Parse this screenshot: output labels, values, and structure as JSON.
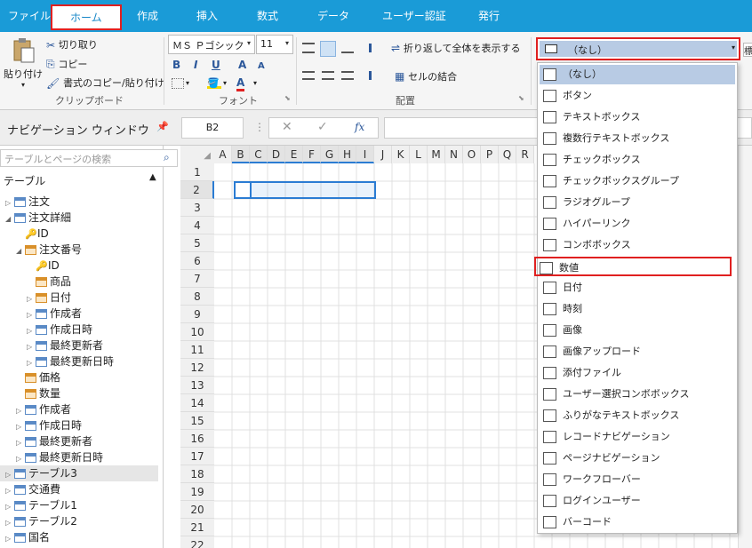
{
  "menu": [
    "ファイル",
    "ホーム",
    "作成",
    "挿入",
    "数式",
    "データ",
    "ユーザー認証",
    "発行"
  ],
  "ribbon": {
    "clipboard": {
      "paste": "貼り付け",
      "cut": "切り取り",
      "copy": "コピー",
      "format_copy": "書式のコピー/貼り付け",
      "label": "クリップボード"
    },
    "font": {
      "name": "ＭＳ Ｐゴシック",
      "size": "11",
      "bold": "B",
      "italic": "I",
      "underline": "U",
      "grow": "A",
      "shrink": "A",
      "color": "A",
      "label": "フォント"
    },
    "alignment": {
      "wrap": "折り返して全体を表示する",
      "merge": "セルの結合",
      "label": "配置"
    },
    "control_type": {
      "selected": "（なし）"
    },
    "right_cut": "標"
  },
  "formula": {
    "cell_ref": "B2",
    "fx": "fx",
    "cancel": "✕",
    "enter": "✓"
  },
  "nav": {
    "title": "ナビゲーション ウィンドウ",
    "search_placeholder": "テーブルとページの検索",
    "section": "テーブル",
    "items": [
      "注文",
      "注文詳細",
      "ID",
      "注文番号",
      "ID",
      "商品",
      "日付",
      "作成者",
      "作成日時",
      "最終更新者",
      "最終更新日時",
      "価格",
      "数量",
      "作成者",
      "作成日時",
      "最終更新者",
      "最終更新日時",
      "テーブル3",
      "交通費",
      "テーブル1",
      "テーブル2",
      "国名"
    ]
  },
  "grid": {
    "columns": [
      "A",
      "B",
      "C",
      "D",
      "E",
      "F",
      "G",
      "H",
      "I",
      "J",
      "K",
      "L",
      "M",
      "N",
      "O",
      "P",
      "Q",
      "R"
    ],
    "rows": [
      "1",
      "2",
      "3",
      "4",
      "5",
      "6",
      "7",
      "8",
      "9",
      "10",
      "11",
      "12",
      "13",
      "14",
      "15",
      "16",
      "17",
      "18",
      "19",
      "20",
      "21",
      "22"
    ]
  },
  "dropdown": {
    "items": [
      "（なし）",
      "ボタン",
      "テキストボックス",
      "複数行テキストボックス",
      "チェックボックス",
      "チェックボックスグループ",
      "ラジオグループ",
      "ハイパーリンク",
      "コンボボックス",
      "数値",
      "日付",
      "時刻",
      "画像",
      "画像アップロード",
      "添付ファイル",
      "ユーザー選択コンボボックス",
      "ふりがなテキストボックス",
      "レコードナビゲーション",
      "ページナビゲーション",
      "ワークフローバー",
      "ログインユーザー",
      "バーコード"
    ],
    "icons": [
      "blank-icon",
      "button-icon",
      "textbox-icon",
      "multiline-textbox-icon",
      "checkbox-icon",
      "checkbox-group-icon",
      "radio-icon",
      "hyperlink-icon",
      "combobox-icon",
      "number-icon",
      "date-icon",
      "clock-icon",
      "image-icon",
      "image-upload-icon",
      "attachment-icon",
      "user-select-icon",
      "furigana-icon",
      "record-nav-icon",
      "page-nav-icon",
      "workflow-icon",
      "login-user-icon",
      "barcode-icon"
    ],
    "highlighted": "数値"
  },
  "colors": {
    "menubar": "#1a9bd7",
    "highlight": "#e02020",
    "selection": "#2b7cd3"
  }
}
